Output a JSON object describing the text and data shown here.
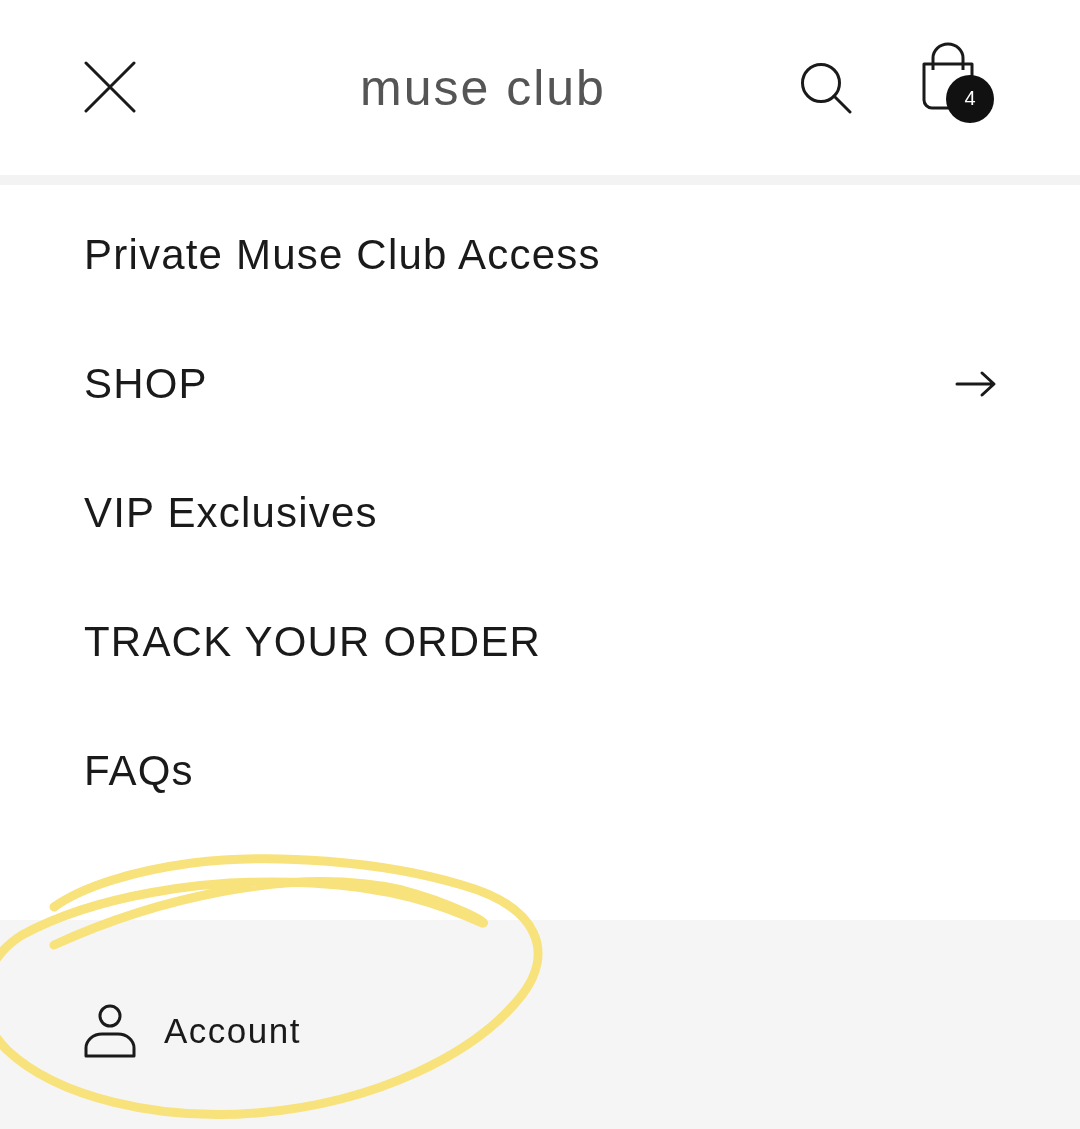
{
  "header": {
    "logo": "muse club",
    "cart_count": "4"
  },
  "menu": [
    {
      "label": "Private Muse Club Access",
      "has_submenu": false
    },
    {
      "label": "SHOP",
      "has_submenu": true
    },
    {
      "label": "VIP Exclusives",
      "has_submenu": false
    },
    {
      "label": "TRACK YOUR ORDER",
      "has_submenu": false
    },
    {
      "label": "FAQs",
      "has_submenu": false
    }
  ],
  "footer": {
    "account_label": "Account"
  },
  "annotation": {
    "kind": "circle"
  }
}
